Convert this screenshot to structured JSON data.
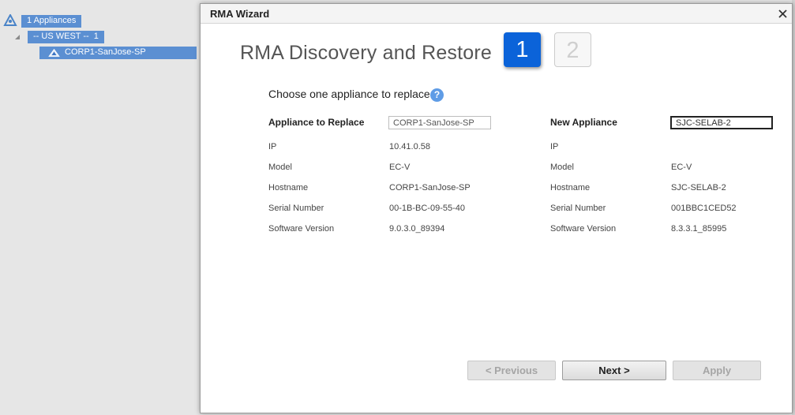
{
  "tree": {
    "root_label": "1 Appliances",
    "region_label": "-- US WEST --  1",
    "appliance_label": "CORP1-SanJose-SP"
  },
  "wizard": {
    "window_title": "RMA Wizard",
    "heading": "RMA Discovery and Restore",
    "steps": [
      "1",
      "2"
    ],
    "active_step": 1,
    "instruction": "Choose one appliance to replace",
    "help_symbol": "?",
    "old_appliance": {
      "header": "Appliance to Replace",
      "input_value": "CORP1-SanJose-SP",
      "rows": [
        {
          "label": "IP",
          "value": "10.41.0.58"
        },
        {
          "label": "Model",
          "value": "EC-V"
        },
        {
          "label": "Hostname",
          "value": "CORP1-SanJose-SP"
        },
        {
          "label": "Serial Number",
          "value": "00-1B-BC-09-55-40"
        },
        {
          "label": "Software Version",
          "value": "9.0.3.0_89394"
        }
      ]
    },
    "new_appliance": {
      "header": "New Appliance",
      "input_value": "SJC-SELAB-2",
      "rows": [
        {
          "label": "IP",
          "value": ""
        },
        {
          "label": "Model",
          "value": "EC-V"
        },
        {
          "label": "Hostname",
          "value": "SJC-SELAB-2"
        },
        {
          "label": "Serial Number",
          "value": "001BBC1CED52"
        },
        {
          "label": "Software Version",
          "value": "8.3.3.1_85995"
        }
      ]
    },
    "buttons": {
      "previous": "< Previous",
      "next": "Next >",
      "apply": "Apply"
    }
  },
  "icons": {
    "root": "network-triangle-icon",
    "appliance": "appliance-triangle-icon",
    "close": "close-icon",
    "help": "help-icon"
  },
  "colors": {
    "tree_selection": "#5b8fd2",
    "active_step": "#0b63d9",
    "help_icon": "#5f9ce6"
  }
}
